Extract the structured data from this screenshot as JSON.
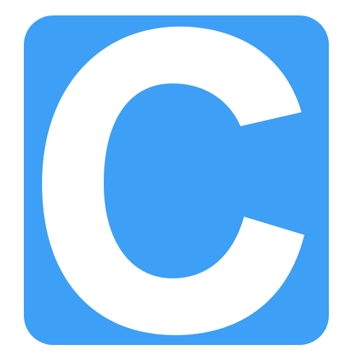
{
  "icon": {
    "name": "c-letter-logo-icon",
    "glyph": "C",
    "colors": {
      "background": "#3d9ff5",
      "letter": "#ffffff"
    }
  }
}
